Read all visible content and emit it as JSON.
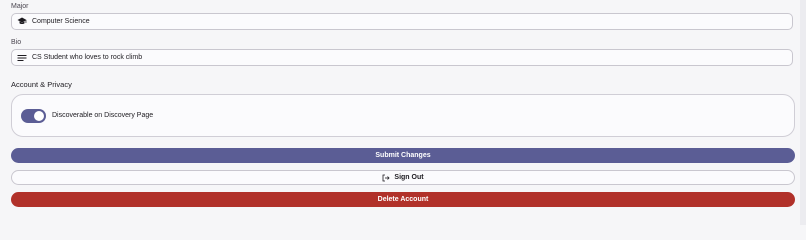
{
  "major": {
    "label": "Major",
    "value": "Computer Science",
    "icon": "graduation-cap-icon"
  },
  "bio": {
    "label": "Bio",
    "value": "CS Student who loves to rock climb",
    "icon": "text-lines-icon"
  },
  "account_privacy": {
    "title": "Account & Privacy",
    "discoverable_label": "Discoverable on Discovery Page",
    "discoverable_on": true
  },
  "actions": {
    "submit_label": "Submit Changes",
    "signout_label": "Sign Out",
    "signout_icon": "logout-icon",
    "delete_label": "Delete Account"
  },
  "colors": {
    "primary": "#5b5d95",
    "danger": "#b1312a",
    "background": "#f6f6f8"
  }
}
